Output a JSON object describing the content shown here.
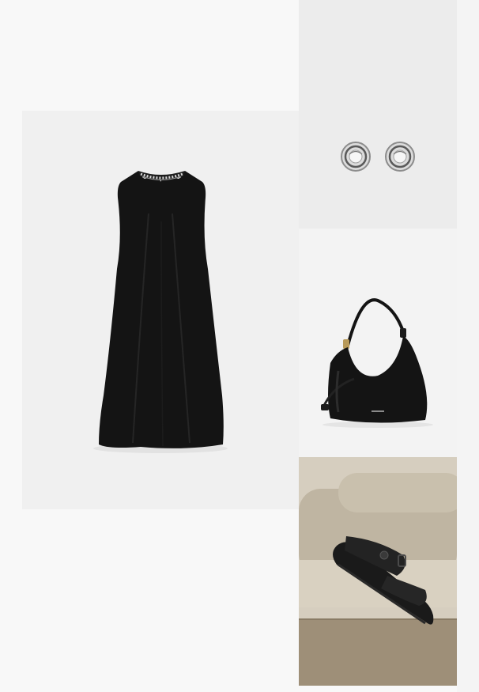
{
  "products": {
    "dress": {
      "icon": "sleeveless-black-dress-image"
    },
    "earrings": {
      "icon": "silver-stud-earrings-image"
    },
    "bag": {
      "icon": "black-leather-shoulder-bag-image"
    },
    "sandals": {
      "icon": "black-strap-sandals-image"
    }
  },
  "colors": {
    "page_background": "#f8f8f8",
    "product_black": "#141414",
    "silver": "#b8b8b8",
    "sandals_backdrop": "#cfc6b5"
  }
}
